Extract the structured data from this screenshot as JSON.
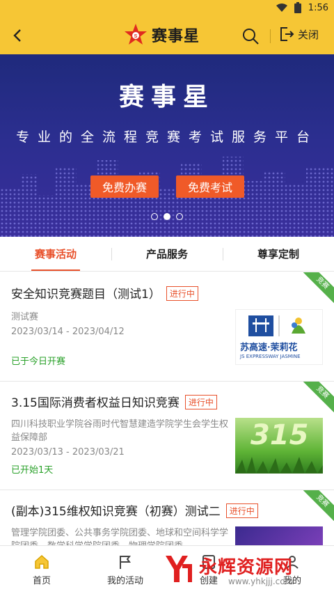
{
  "status_bar": {
    "time": "1:56"
  },
  "header": {
    "title": "赛事星",
    "close_label": "关闭"
  },
  "banner": {
    "title": "赛事星",
    "subtitle": "专业的全流程竞赛考试服务平台",
    "buttons": [
      "免费办赛",
      "免费考试"
    ],
    "page_count": 3,
    "active_page": 2
  },
  "tabs": [
    {
      "label": "赛事活动",
      "active": true
    },
    {
      "label": "产品服务",
      "active": false
    },
    {
      "label": "尊享定制",
      "active": false
    }
  ],
  "cards": [
    {
      "title": "安全知识竞赛题目（测试1）",
      "status": "进行中",
      "org": "测试赛",
      "date": "2023/03/14 - 2023/04/12",
      "state": "已于今日开赛",
      "ribbon": "竞赛",
      "thumb_caption": "苏高速·茉莉花",
      "thumb_caption_en": "JS EXPRESSWAY JASMINE"
    },
    {
      "title": "3.15国际消费者权益日知识竞赛",
      "status": "进行中",
      "org": "四川科技职业学院谷雨时代智慧建造学院学生会学生权益保障部",
      "date": "2023/03/13 - 2023/03/21",
      "state": "已开始1天",
      "ribbon": "竞赛",
      "thumb_caption": "315"
    },
    {
      "title": "(副本)315维权知识竞赛（初赛）测试二",
      "status": "进行中",
      "org": "管理学院团委、公共事务学院团委、地球和空间科学学院团委、数学科学学院团委、物理学院团委",
      "ribbon": "竞赛"
    }
  ],
  "bottom_nav": [
    {
      "label": "首页",
      "icon": "home-icon",
      "active": true
    },
    {
      "label": "我的活动",
      "icon": "flag-icon",
      "active": false
    },
    {
      "label": "创建",
      "icon": "create-icon",
      "active": false
    },
    {
      "label": "我的",
      "icon": "profile-icon",
      "active": false
    }
  ],
  "watermark": {
    "text": "永辉资源网",
    "url": "www.yhkjjj.com"
  },
  "colors": {
    "brand_yellow": "#f6c635",
    "accent_orange": "#e8502a",
    "green": "#2aa12a"
  }
}
